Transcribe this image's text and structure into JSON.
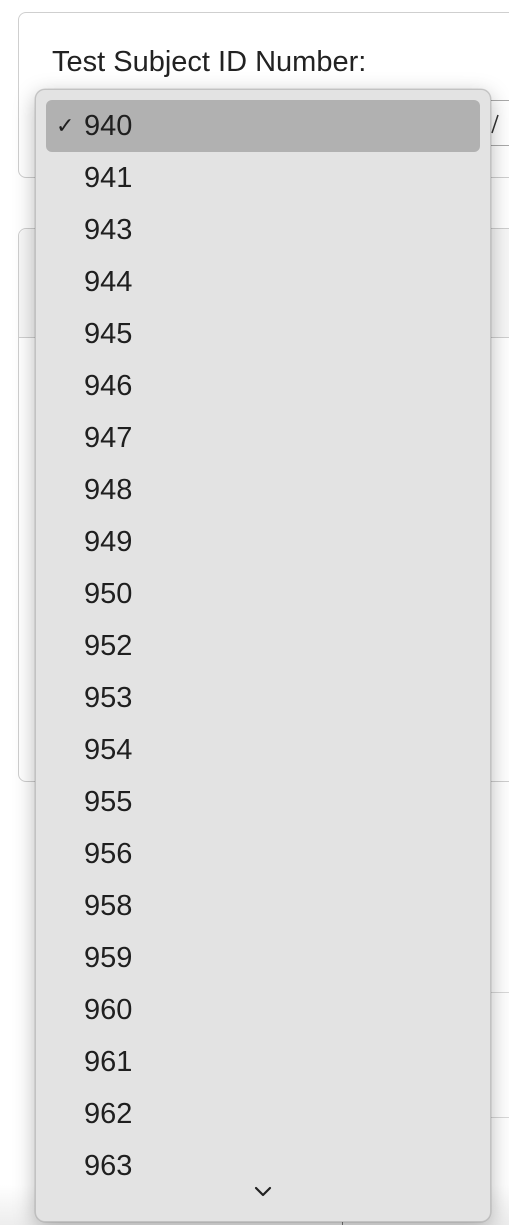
{
  "form": {
    "field_label": "Test Subject ID Number:",
    "selected_value": "940"
  },
  "dropdown": {
    "selected_index": 0,
    "options": [
      "940",
      "941",
      "943",
      "944",
      "945",
      "946",
      "947",
      "948",
      "949",
      "950",
      "952",
      "953",
      "954",
      "955",
      "956",
      "958",
      "959",
      "960",
      "961",
      "962",
      "963"
    ],
    "check_icon": "checkmark-icon",
    "scroll_icon": "chevron-down-icon"
  }
}
